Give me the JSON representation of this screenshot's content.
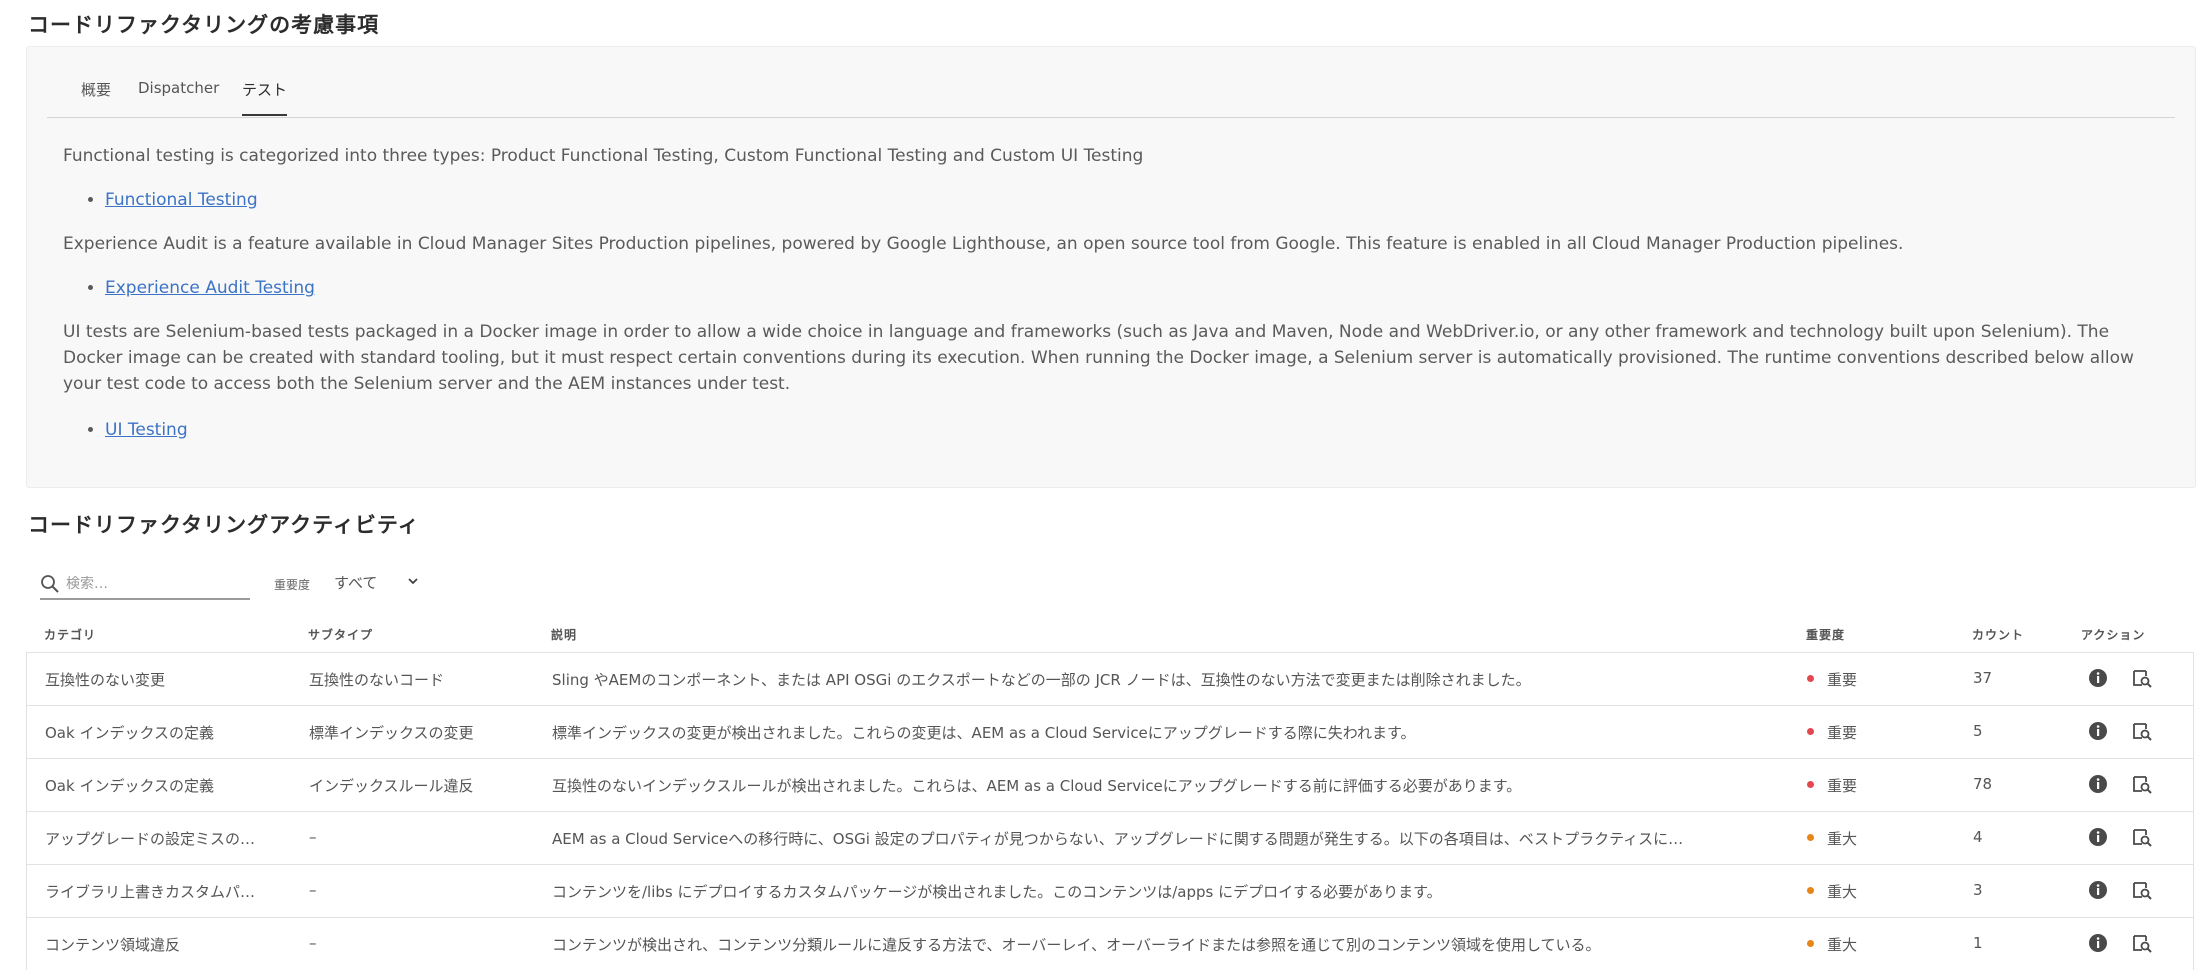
{
  "considerations": {
    "title": "コードリファクタリングの考慮事項",
    "tabs": [
      {
        "label": "概要"
      },
      {
        "label": "Dispatcher"
      },
      {
        "label": "テスト"
      }
    ],
    "active_tab": "テスト",
    "paragraph1": "Functional testing is categorized into three types: Product Functional Testing, Custom Functional Testing and Custom UI Testing",
    "link1": "Functional Testing",
    "paragraph2": "Experience Audit is a feature available in Cloud Manager Sites Production pipelines, powered by Google Lighthouse, an open source tool from Google. This feature is enabled in all Cloud Manager Production pipelines.",
    "link2": "Experience Audit Testing",
    "paragraph3": "UI tests are Selenium-based tests packaged in a Docker image in order to allow a wide choice in language and frameworks (such as Java and Maven, Node and WebDriver.io, or any other framework and technology built upon Selenium). The Docker image can be created with standard tooling, but it must respect certain conventions during its execution. When running the Docker image, a Selenium server is automatically provisioned. The runtime conventions described below allow your test code to access both the Selenium server and the AEM instances under test.",
    "link3": "UI Testing"
  },
  "activities": {
    "title": "コードリファクタリングアクティビティ",
    "search_placeholder": "検索…",
    "severity_label": "重要度",
    "severity_value": "すべて",
    "columns": {
      "category": "カテゴリ",
      "subtype": "サブタイプ",
      "description": "説明",
      "severity": "重要度",
      "count": "カウント",
      "action": "アクション"
    },
    "rows": [
      {
        "category": "互換性のない変更",
        "subtype": "互換性のないコード",
        "description": "Sling やAEMのコンポーネント、または API OSGi のエクスポートなどの一部の JCR ノードは、互換性のない方法で変更または削除されました。",
        "severity": "重要",
        "severity_color": "#e34850",
        "count": "37"
      },
      {
        "category": "Oak インデックスの定義",
        "subtype": "標準インデックスの変更",
        "description": "標準インデックスの変更が検出されました。これらの変更は、AEM as a Cloud Serviceにアップグレードする際に失われます。",
        "severity": "重要",
        "severity_color": "#e34850",
        "count": "5"
      },
      {
        "category": "Oak インデックスの定義",
        "subtype": "インデックスルール違反",
        "description": "互換性のないインデックスルールが検出されました。これらは、AEM as a Cloud Serviceにアップグレードする前に評価する必要があります。",
        "severity": "重要",
        "severity_color": "#e34850",
        "count": "78"
      },
      {
        "category": "アップグレードの設定ミスの…",
        "subtype": "–",
        "description": "AEM as a Cloud Serviceへの移行時に、OSGi 設定のプロパティが見つからない、アップグレードに関する問題が発生する。以下の各項目は、ベストプラクティスに…",
        "severity": "重大",
        "severity_color": "#e68619",
        "count": "4"
      },
      {
        "category": "ライブラリ上書きカスタムパ…",
        "subtype": "–",
        "description": "コンテンツを/libs にデプロイするカスタムパッケージが検出されました。このコンテンツは/apps にデプロイする必要があります。",
        "severity": "重大",
        "severity_color": "#e68619",
        "count": "3"
      },
      {
        "category": "コンテンツ領域違反",
        "subtype": "–",
        "description": "コンテンツが検出され、コンテンツ分類ルールに違反する方法で、オーバーレイ、オーバーライドまたは参照を通じて別のコンテンツ領域を使用している。",
        "severity": "重大",
        "severity_color": "#e68619",
        "count": "1"
      }
    ]
  },
  "icons": {
    "search": "search-icon",
    "chevron": "chevron-down-icon",
    "info": "info-icon",
    "preview": "preview-icon"
  }
}
